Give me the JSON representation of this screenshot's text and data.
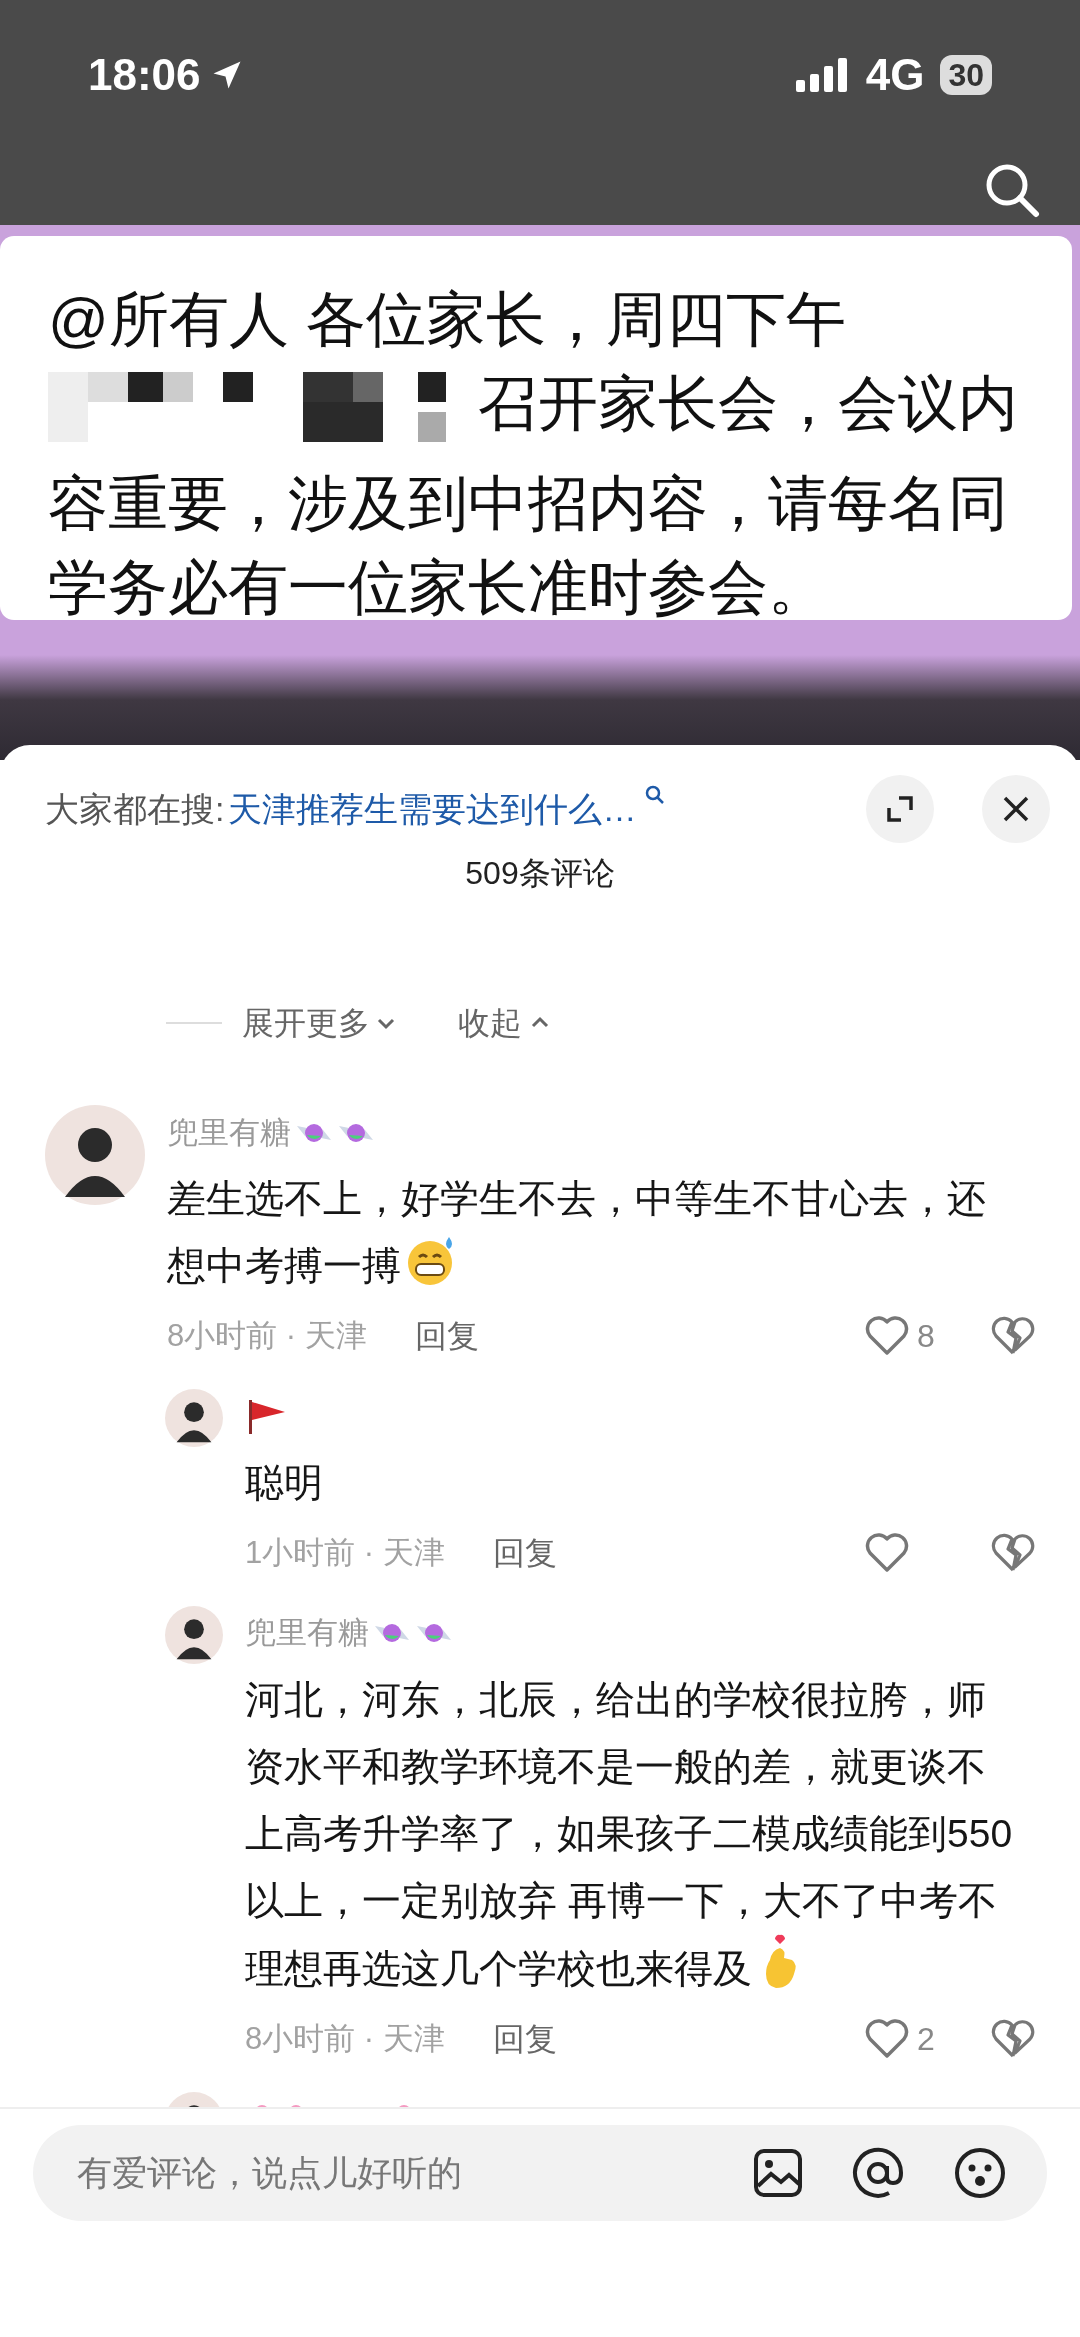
{
  "status_bar": {
    "time": "18:06",
    "network": "4G",
    "battery": "30"
  },
  "video": {
    "message_parts": [
      {
        "kind": "text",
        "text": "@所有人 各位家长，周四下午"
      },
      {
        "kind": "redacted"
      },
      {
        "kind": "text",
        "text": "召开家长会，会议内"
      },
      {
        "kind": "text",
        "text": "容重要，涉及到中招内容，请每名同学务必有一位家长准时参会。"
      }
    ]
  },
  "sheet": {
    "search_prefix": "大家都在搜:",
    "search_suggestion": "天津推荐生需要达到什么…",
    "title": "509条评论",
    "expand_more": "展开更多",
    "collapse": "收起"
  },
  "comments": [
    {
      "name": "兜里有糖",
      "name_icons": [
        {
          "kind": "candy"
        },
        {
          "kind": "candy"
        }
      ],
      "text": "差生选不上，好学生不去，中等生不甘心去，还想中考搏一搏",
      "emoji": {
        "kind": "grin-sweat"
      },
      "time_place": "8小时前 · 天津",
      "reply": "回复",
      "likes": "8",
      "liked": false,
      "replies": [
        {
          "name_icons": [
            {
              "kind": "flag"
            }
          ],
          "text": "聪明",
          "time_place": "1小时前 · 天津",
          "reply": "回复",
          "liked": false
        },
        {
          "name": "兜里有糖",
          "name_icons": [
            {
              "kind": "candy"
            },
            {
              "kind": "candy"
            }
          ],
          "text": "河北，河东，北辰，给出的学校很拉胯，师资水平和教学环境不是一般的差，就更谈不上高考升学率了，如果孩子二模成绩能到550以上，一定别放弃 再博一下，大不了中考不理想再选这几个学校也来得及",
          "emoji": {
            "kind": "finger-heart"
          },
          "time_place": "8小时前 · 天津",
          "reply": "回复",
          "likes": "2",
          "liked": false
        },
        {
          "name_icons_before": [
            {
              "kind": "flower"
            }
          ],
          "name_icons": [
            {
              "kind": "flower"
            }
          ]
        }
      ]
    }
  ],
  "input": {
    "placeholder": "有爱评论，说点儿好听的"
  }
}
